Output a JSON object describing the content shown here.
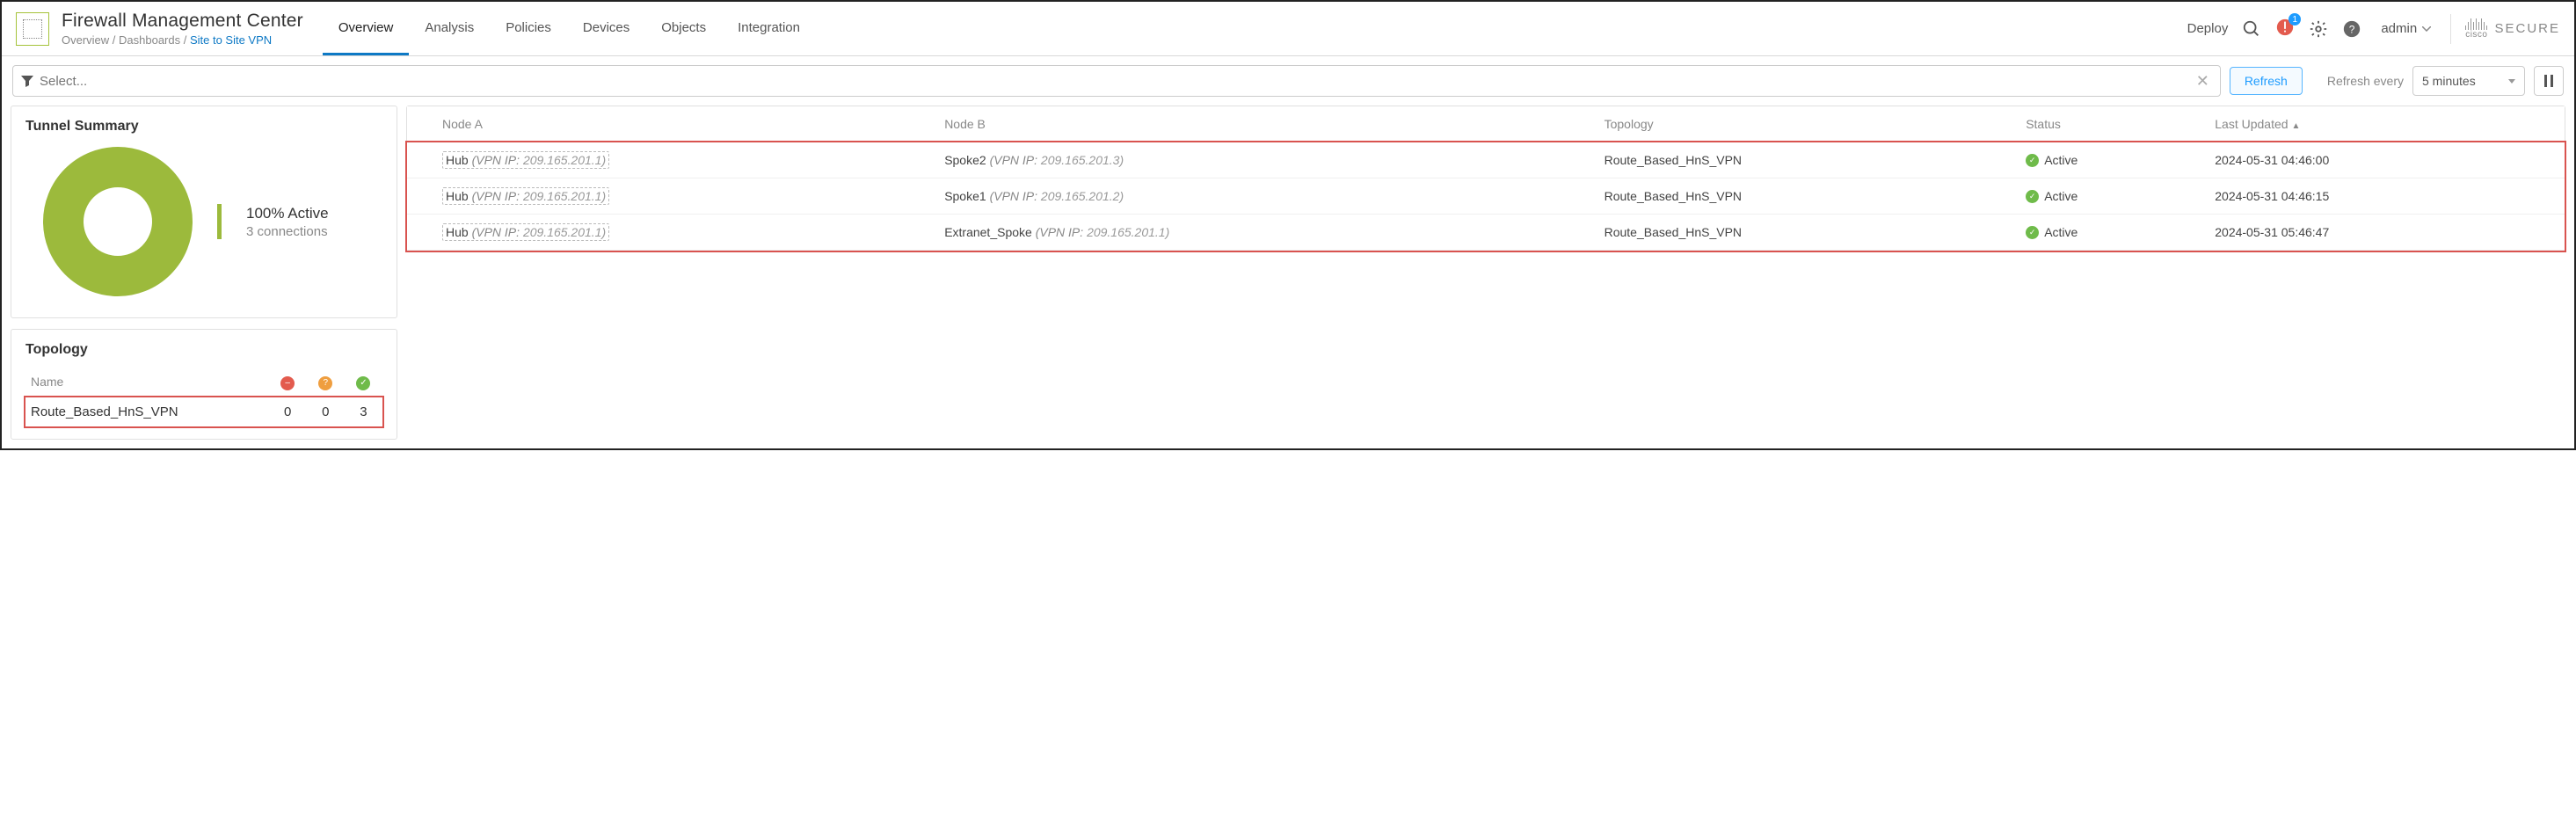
{
  "header": {
    "app_title": "Firewall Management Center",
    "breadcrumb_prefix": "Overview / Dashboards / ",
    "breadcrumb_current": "Site to Site VPN",
    "nav": [
      "Overview",
      "Analysis",
      "Policies",
      "Devices",
      "Objects",
      "Integration"
    ],
    "active_nav": "Overview",
    "deploy_label": "Deploy",
    "alert_count": "1",
    "user_label": "admin",
    "secure_brand": "SECURE",
    "cisco_label": "cisco"
  },
  "filter": {
    "placeholder": "Select...",
    "refresh_label": "Refresh",
    "refresh_every_label": "Refresh every",
    "interval_value": "5 minutes"
  },
  "tunnel_summary": {
    "title": "Tunnel Summary",
    "active_pct": "100% Active",
    "connections": "3 connections"
  },
  "topology": {
    "title": "Topology",
    "name_col": "Name",
    "row": {
      "name": "Route_Based_HnS_VPN",
      "down": "0",
      "warn": "0",
      "up": "3"
    }
  },
  "table": {
    "columns": {
      "nodeA": "Node A",
      "nodeB": "Node B",
      "topology": "Topology",
      "status": "Status",
      "last_updated": "Last Updated"
    },
    "rows": [
      {
        "nodeA_name": "Hub",
        "nodeA_ip": "209.165.201.1",
        "nodeB_name": "Spoke2",
        "nodeB_ip": "209.165.201.3",
        "topology": "Route_Based_HnS_VPN",
        "status": "Active",
        "last_updated": "2024-05-31 04:46:00"
      },
      {
        "nodeA_name": "Hub",
        "nodeA_ip": "209.165.201.1",
        "nodeB_name": "Spoke1",
        "nodeB_ip": "209.165.201.2",
        "topology": "Route_Based_HnS_VPN",
        "status": "Active",
        "last_updated": "2024-05-31 04:46:15"
      },
      {
        "nodeA_name": "Hub",
        "nodeA_ip": "209.165.201.1",
        "nodeB_name": "Extranet_Spoke",
        "nodeB_ip": "209.165.201.1",
        "topology": "Route_Based_HnS_VPN",
        "status": "Active",
        "last_updated": "2024-05-31 05:46:47"
      }
    ]
  },
  "chart_data": {
    "type": "pie",
    "title": "Tunnel Summary",
    "categories": [
      "Active"
    ],
    "values": [
      3
    ],
    "colors": [
      "#9cba3c"
    ],
    "total": 3,
    "percent_label": "100% Active"
  },
  "vpn_ip_prefix": "(VPN IP:  ",
  "vpn_ip_suffix": ")"
}
